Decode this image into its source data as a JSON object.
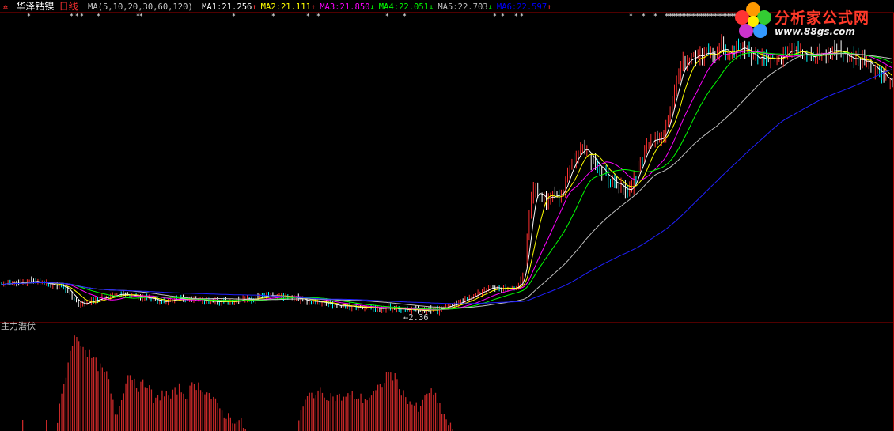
{
  "header": {
    "stock_name": "华泽钴镍",
    "period": "日线",
    "ma_params": "MA(5,10,20,30,60,120)",
    "ma_items": [
      {
        "label": "MA1:",
        "value": "21.256",
        "arrow": "↑",
        "color": "#ffffff"
      },
      {
        "label": "MA2:",
        "value": "21.111",
        "arrow": "↑",
        "color": "#ffff00"
      },
      {
        "label": "MA3:",
        "value": "21.850",
        "arrow": "↓",
        "color": "#ff00ff"
      },
      {
        "label": "MA4:",
        "value": "22.051",
        "arrow": "↓",
        "color": "#00ff00"
      },
      {
        "label": "MA5:",
        "value": "22.703",
        "arrow": "↓",
        "color": "#c0c0c0"
      },
      {
        "label": "MA6:",
        "value": "22.597",
        "arrow": "↑",
        "color": "#0000ff"
      }
    ]
  },
  "main_chart": {
    "low_price_label": "2.36",
    "colors": {
      "up": "#ff3030",
      "down": "#00ffff",
      "frame": "#a00000"
    }
  },
  "indicator": {
    "title": "主力潜伏",
    "bar_color": "#c82828"
  },
  "watermark": {
    "brand": "分析家公式网",
    "url": "www.88gs.com"
  }
}
